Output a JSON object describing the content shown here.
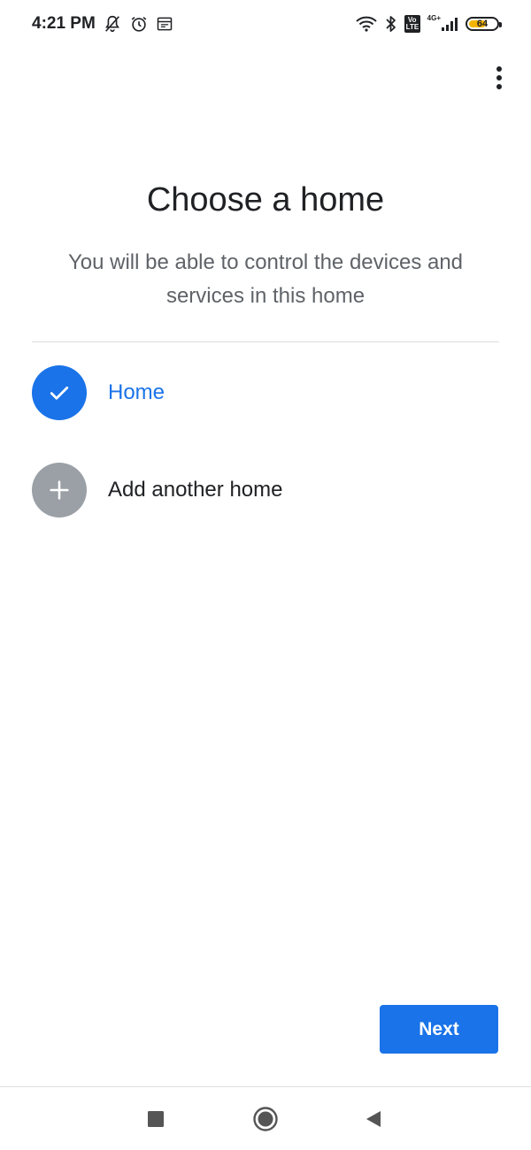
{
  "status_bar": {
    "time": "4:21 PM",
    "left_icons": [
      "notifications-off-icon",
      "alarm-icon",
      "calendar-icon"
    ],
    "right_icons": [
      "wifi-icon",
      "bluetooth-icon",
      "volte-icon",
      "signal-icon",
      "battery-icon"
    ],
    "volte_label": "Vo LTE",
    "network_type": "4G+",
    "battery_level": "64",
    "battery_fraction": 0.64,
    "battery_color": "#f4b400"
  },
  "toolbar": {
    "menu_icon": "more-vert-icon"
  },
  "header": {
    "title": "Choose a home",
    "subtitle": "You will be able to control the devices and services in this home"
  },
  "homes": [
    {
      "label": "Home",
      "icon": "check-icon",
      "selected": true
    },
    {
      "label": "Add another home",
      "icon": "add-icon",
      "selected": false
    }
  ],
  "actions": {
    "next_label": "Next"
  },
  "nav_bar": {
    "buttons": [
      "recent-apps-icon",
      "home-icon",
      "back-icon"
    ]
  },
  "colors": {
    "accent": "#1a73e8",
    "inactive": "#9aa0a6",
    "text": "#202124",
    "secondary_text": "#5f6368"
  }
}
